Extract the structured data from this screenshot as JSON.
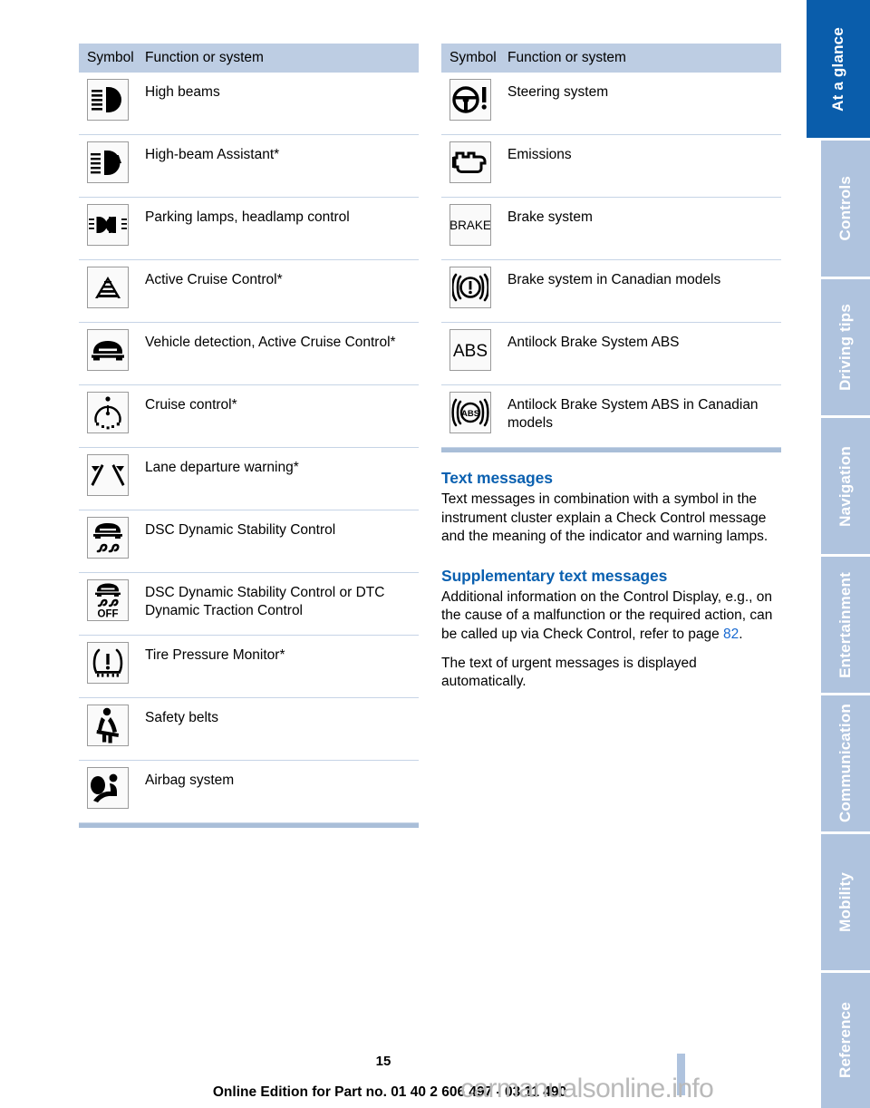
{
  "table_headers": {
    "symbol": "Symbol",
    "function": "Function or system"
  },
  "left_table": [
    {
      "icon": "high-beams-icon",
      "label": "High beams"
    },
    {
      "icon": "high-beam-assistant-icon",
      "label": "High-beam Assistant*"
    },
    {
      "icon": "parking-lamps-icon",
      "label": "Parking lamps, headlamp control"
    },
    {
      "icon": "active-cruise-control-icon",
      "label": "Active Cruise Control*"
    },
    {
      "icon": "vehicle-detection-icon",
      "label": "Vehicle detection, Active Cruise Control*"
    },
    {
      "icon": "cruise-control-icon",
      "label": "Cruise control*"
    },
    {
      "icon": "lane-departure-warning-icon",
      "label": "Lane departure warning*"
    },
    {
      "icon": "dsc-icon",
      "label": "DSC Dynamic Stability Control"
    },
    {
      "icon": "dsc-off-icon",
      "label": "DSC Dynamic Stability Control or DTC Dynamic Traction Control"
    },
    {
      "icon": "tire-pressure-monitor-icon",
      "label": "Tire Pressure Monitor*"
    },
    {
      "icon": "safety-belts-icon",
      "label": "Safety belts"
    },
    {
      "icon": "airbag-system-icon",
      "label": "Airbag system"
    }
  ],
  "right_table": [
    {
      "icon": "steering-system-icon",
      "label": "Steering system"
    },
    {
      "icon": "emissions-icon",
      "label": "Emissions"
    },
    {
      "icon": "brake-system-icon",
      "label": "Brake system"
    },
    {
      "icon": "brake-system-canada-icon",
      "label": "Brake system in Canadian models"
    },
    {
      "icon": "abs-icon",
      "label": "Antilock Brake System ABS"
    },
    {
      "icon": "abs-canada-icon",
      "label": "Antilock Brake System ABS in Canadian models"
    }
  ],
  "sections": {
    "text_messages": {
      "heading": "Text messages",
      "body": "Text messages in combination with a symbol in the instrument cluster explain a Check Control message and the meaning of the indicator and warning lamps."
    },
    "supplementary": {
      "heading": "Supplementary text messages",
      "body_before_ref": "Additional information on the Control Display, e.g., on the cause of a malfunction or the required action, can be called up via Check Control, refer to page ",
      "page_ref": "82",
      "body_after_ref": ".",
      "body2": "The text of urgent messages is displayed automatically."
    }
  },
  "tabs": [
    {
      "label": "At a glance",
      "active": true
    },
    {
      "label": "Controls",
      "active": false
    },
    {
      "label": "Driving tips",
      "active": false
    },
    {
      "label": "Navigation",
      "active": false
    },
    {
      "label": "Entertainment",
      "active": false
    },
    {
      "label": "Communication",
      "active": false
    },
    {
      "label": "Mobility",
      "active": false
    },
    {
      "label": "Reference",
      "active": false
    }
  ],
  "footer": {
    "page_number": "15",
    "edition_line": "Online Edition for Part no. 01 40 2 606 497 - 03 11 490",
    "watermark": "carmanualsonline.info"
  },
  "colors": {
    "header_bar": "#bdcde3",
    "tab_inactive": "#afc3de",
    "tab_active": "#0a5dab",
    "heading_blue": "#0a60b0",
    "link_blue": "#1768d0",
    "row_rule": "#c6d4e6"
  }
}
